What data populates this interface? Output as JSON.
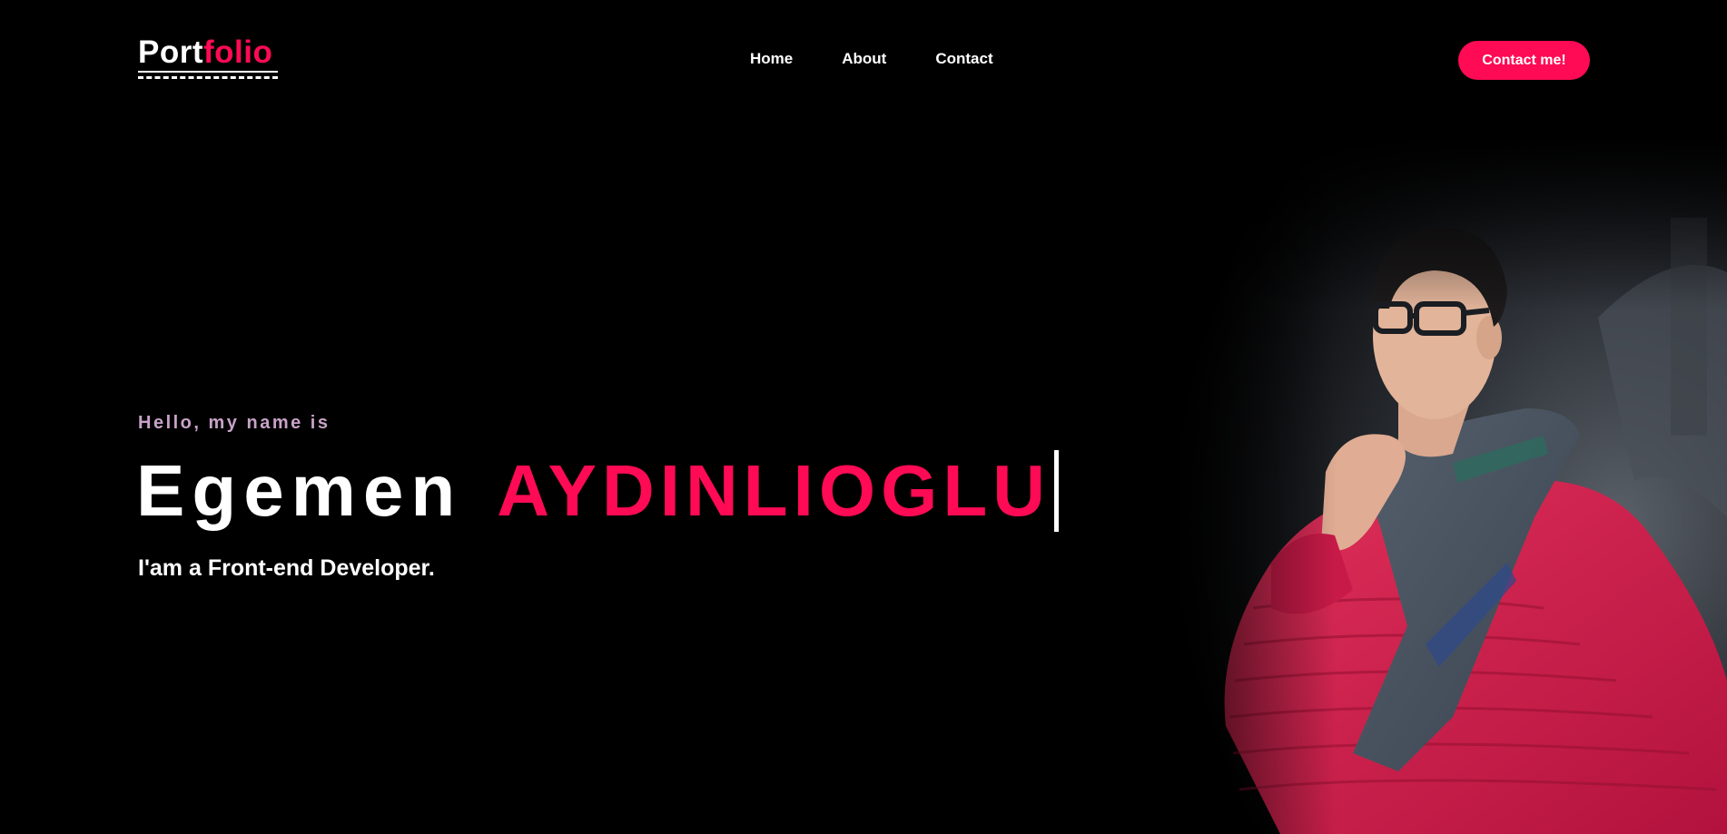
{
  "nav": {
    "logo_part1": "Port",
    "logo_part2": "folio",
    "links": [
      {
        "label": "Home"
      },
      {
        "label": "About"
      },
      {
        "label": "Contact"
      }
    ],
    "cta_label": "Contact me!"
  },
  "hero": {
    "greeting": "Hello, my name is",
    "first_name": "Egemen",
    "last_name": "AYDINLIOGLU",
    "role": "I'am a Front-end Developer."
  },
  "colors": {
    "background": "#000000",
    "accent": "#ff0a54",
    "greeting": "#c8a2c8",
    "text": "#ffffff"
  }
}
